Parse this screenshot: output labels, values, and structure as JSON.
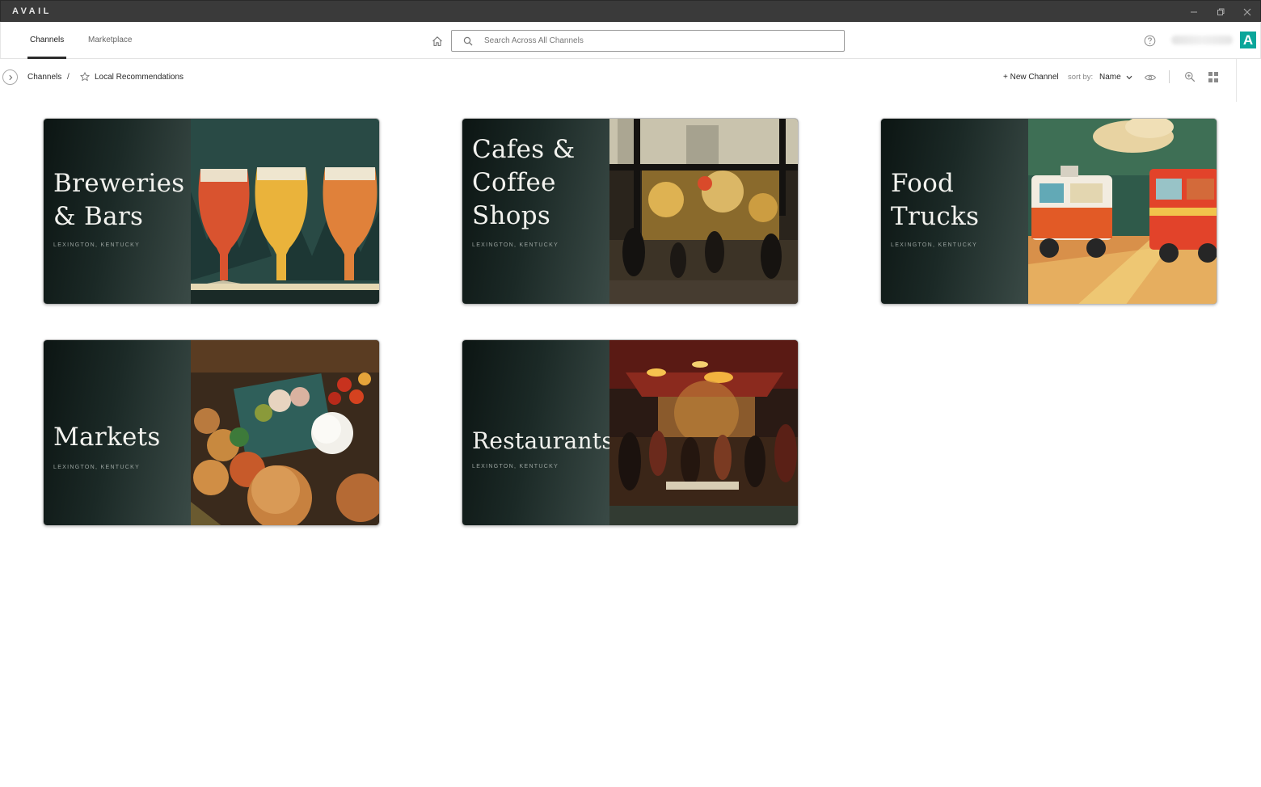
{
  "app": {
    "title": "AVAIL"
  },
  "colors": {
    "titlebar": "#3a3a3a",
    "accent": "#0aa69a",
    "card_dark": "#1b2926"
  },
  "window_controls": {
    "minimize": "minimize-icon",
    "restore": "restore-icon",
    "close": "close-icon"
  },
  "nav": {
    "tabs": [
      {
        "label": "Channels",
        "active": true
      },
      {
        "label": "Marketplace",
        "active": false
      }
    ],
    "search_placeholder": "Search Across All Channels",
    "avatar_letter": "A"
  },
  "breadcrumb": {
    "root": "Channels",
    "separator": "/",
    "current": "Local Recommendations"
  },
  "toolbar": {
    "new_channel": "+ New Channel",
    "sort_label": "sort by:",
    "sort_value": "Name"
  },
  "cards": [
    {
      "title": "Breweries\n& Bars",
      "subtitle": "LEXINGTON, KENTUCKY"
    },
    {
      "title": "Cafes &\nCoffee\nShops",
      "subtitle": "LEXINGTON, KENTUCKY"
    },
    {
      "title": "Food\nTrucks",
      "subtitle": "LEXINGTON, KENTUCKY"
    },
    {
      "title": "Markets",
      "subtitle": "LEXINGTON, KENTUCKY"
    },
    {
      "title": "Restaurants",
      "subtitle": "LEXINGTON, KENTUCKY"
    }
  ]
}
